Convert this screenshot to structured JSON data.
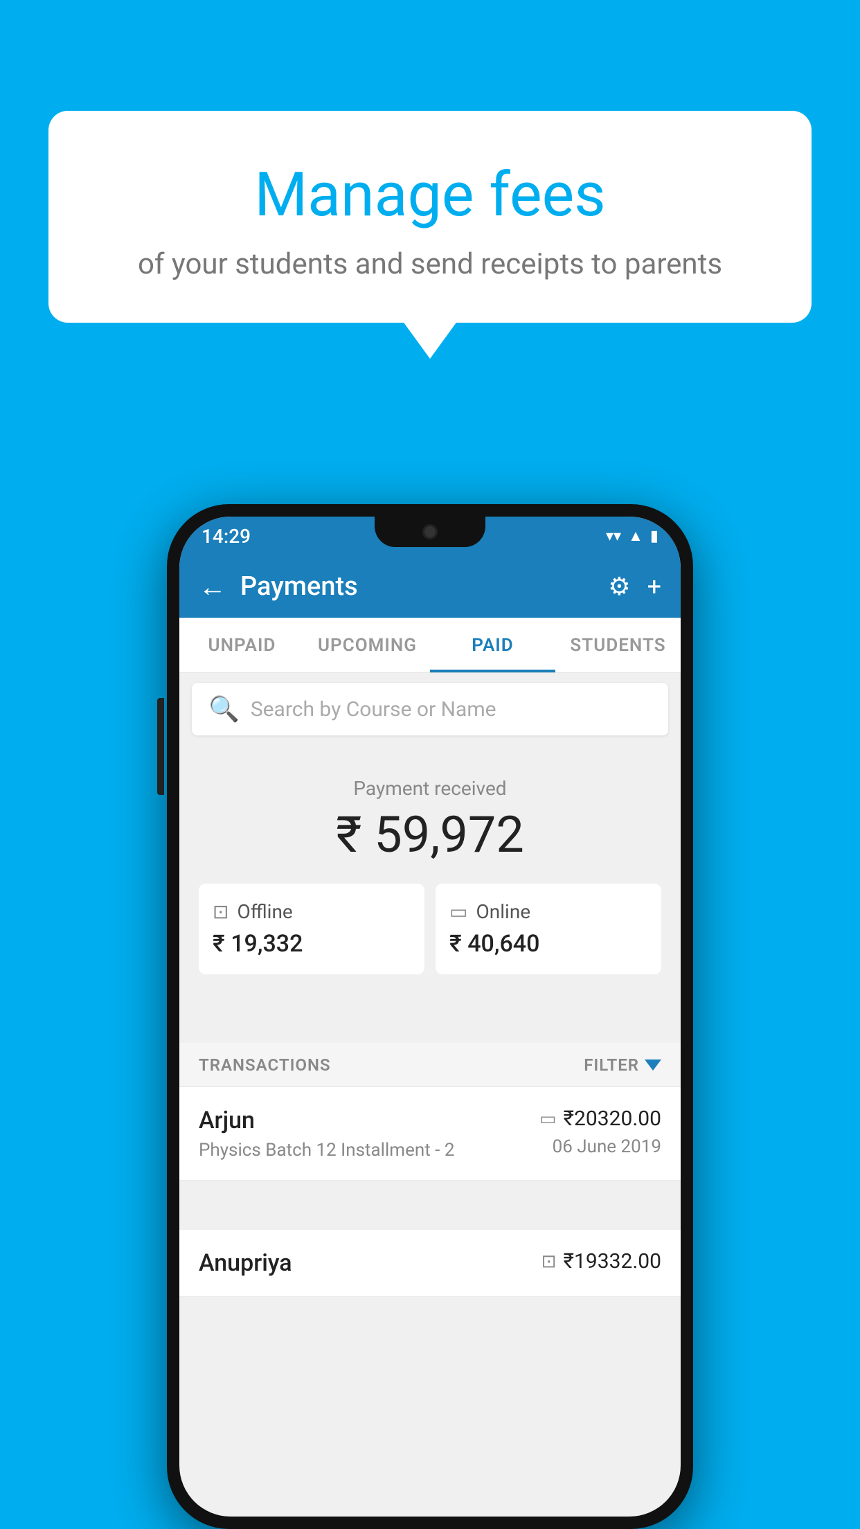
{
  "background_color": "#00AEEF",
  "speech_bubble": {
    "heading": "Manage fees",
    "subtext": "of your students and send receipts to parents"
  },
  "status_bar": {
    "time": "14:29",
    "wifi": "▲",
    "signal": "▲",
    "battery": "▮"
  },
  "header": {
    "title": "Payments",
    "back_label": "←",
    "settings_label": "⚙",
    "add_label": "+"
  },
  "tabs": [
    {
      "label": "UNPAID",
      "active": false
    },
    {
      "label": "UPCOMING",
      "active": false
    },
    {
      "label": "PAID",
      "active": true
    },
    {
      "label": "STUDENTS",
      "active": false
    }
  ],
  "search": {
    "placeholder": "Search by Course or Name"
  },
  "payment_summary": {
    "label": "Payment received",
    "total": "₹ 59,972",
    "offline": {
      "icon": "offline-icon",
      "label": "Offline",
      "amount": "₹ 19,332"
    },
    "online": {
      "icon": "online-icon",
      "label": "Online",
      "amount": "₹ 40,640"
    }
  },
  "transactions": {
    "header_label": "TRANSACTIONS",
    "filter_label": "FILTER",
    "rows": [
      {
        "name": "Arjun",
        "detail": "Physics Batch 12 Installment - 2",
        "amount": "₹20320.00",
        "date": "06 June 2019",
        "icon": "credit-card"
      },
      {
        "name": "Anupriya",
        "detail": "",
        "amount": "₹19332.00",
        "date": "",
        "icon": "cash"
      }
    ]
  }
}
